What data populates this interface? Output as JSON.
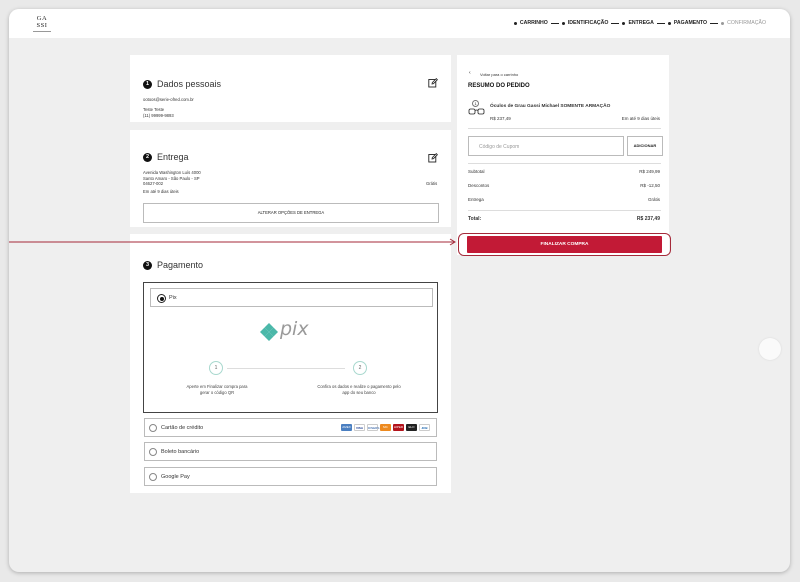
{
  "header": {
    "logo_line1": "GA",
    "logo_line2": "SSI",
    "steps": [
      "CARRINHO",
      "IDENTIFICAÇÃO",
      "ENTREGA",
      "PAGAMENTO",
      "CONFIRMAÇÃO"
    ]
  },
  "personal": {
    "number": "1",
    "title": "Dados pessoais",
    "email": "ootoos@serie-ofred.com.br",
    "name": "Teste Teste",
    "phone": "(11) 99999-9893"
  },
  "delivery": {
    "number": "2",
    "title": "Entrega",
    "address1": "Avenida Washington Luís 4000",
    "address2": "Santo Amaro - São Paulo - SP",
    "zip": "04627-002",
    "eta": "Em até 9 dias úteis",
    "price": "Grátis",
    "change_button": "ALTERAR OPÇÕES DE ENTREGA"
  },
  "payment": {
    "number": "3",
    "title": "Pagamento",
    "pix_label": "Pix",
    "pix_logo_text": "pix",
    "step1_num": "1",
    "step1_text": "Aperte em Finalizar compra para gerar o código QR",
    "step2_num": "2",
    "step2_text": "Confira os dados e realize o pagamento pelo app do seu banco",
    "options": [
      "Cartão de crédito",
      "Boleto bancário",
      "Google Pay"
    ],
    "card_brands": [
      "AMEX",
      "VISA",
      "DINERS",
      "MC",
      "HIPER",
      "ELO",
      "JCB"
    ]
  },
  "summary": {
    "back_link": "Voltar para o carrinho",
    "title": "RESUMO DO PEDIDO",
    "item_qty": "1",
    "item_name": "Óculos de Grau Gassi Michael SOMENTE ARMAÇÃO",
    "item_price": "R$ 237,49",
    "item_eta": "Em até 9 dias úteis",
    "coupon_placeholder": "Código de Cupom",
    "coupon_button": "ADICIONAR",
    "subtotal_label": "Subtotal",
    "subtotal_value": "R$ 249,99",
    "discount_label": "Descontos",
    "discount_value": "R$ -12,50",
    "shipping_label": "Entrega",
    "shipping_value": "Grátis",
    "total_label": "Total:",
    "total_value": "R$ 237,49",
    "finalize_button": "FINALIZAR COMPRA"
  },
  "colors": {
    "accent": "#c21a36",
    "highlight": "#a52a3a",
    "pix_teal": "#4bb8a9"
  }
}
